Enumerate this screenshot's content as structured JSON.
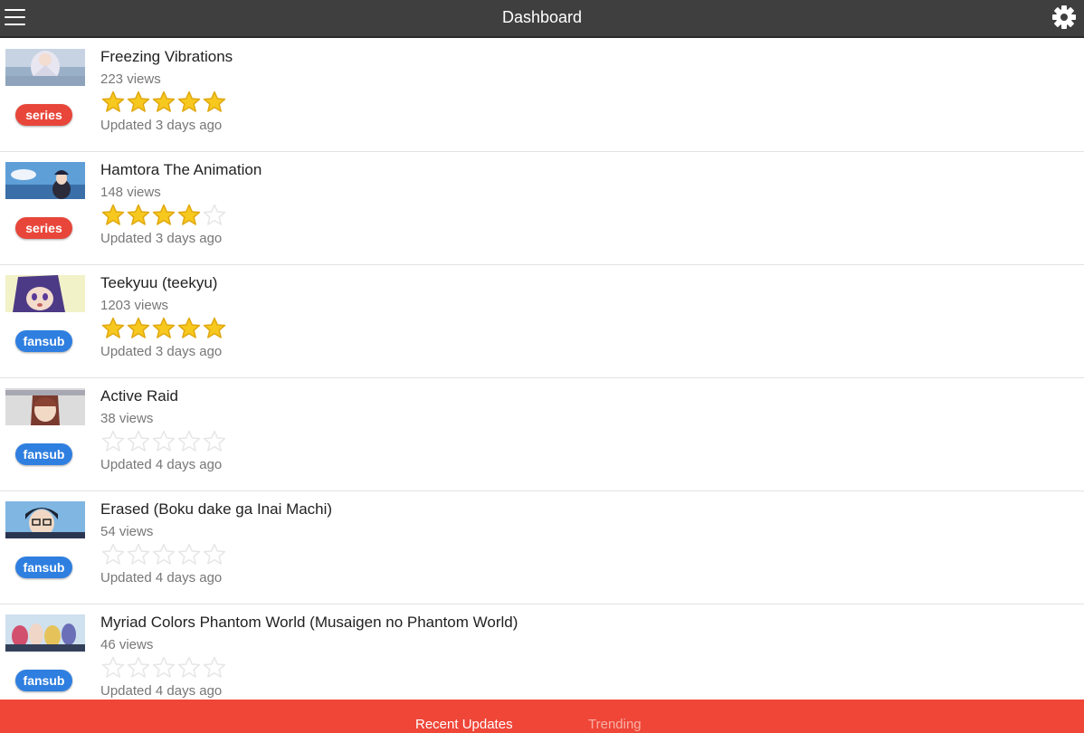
{
  "header": {
    "title": "Dashboard",
    "menu_icon": "hamburger-menu-icon",
    "settings_icon": "gear-icon"
  },
  "items": [
    {
      "title": "Freezing Vibrations",
      "views": "223 views",
      "rating": 5,
      "badge": "series",
      "updated": "Updated 3 days ago"
    },
    {
      "title": "Hamtora The Animation",
      "views": "148 views",
      "rating": 4,
      "badge": "series",
      "updated": "Updated 3 days ago"
    },
    {
      "title": "Teekyuu (teekyu)",
      "views": "1203 views",
      "rating": 5,
      "badge": "fansub",
      "updated": "Updated 3 days ago"
    },
    {
      "title": "Active Raid",
      "views": "38 views",
      "rating": 0,
      "badge": "fansub",
      "updated": "Updated 4 days ago"
    },
    {
      "title": "Erased (Boku dake ga Inai Machi)",
      "views": "54 views",
      "rating": 0,
      "badge": "fansub",
      "updated": "Updated 4 days ago"
    },
    {
      "title": "Myriad Colors Phantom World (Musaigen no Phantom World)",
      "views": "46 views",
      "rating": 0,
      "badge": "fansub",
      "updated": "Updated 4 days ago"
    }
  ],
  "tabs": {
    "recent": "Recent Updates",
    "trending": "Trending"
  },
  "colors": {
    "topbar": "#3f3f3f",
    "bottombar": "#ef4638",
    "badge_series": "#e8463a",
    "badge_fansub": "#2f7fe0",
    "star_filled": "#f7c81e",
    "star_empty": "#e6e6e6"
  }
}
